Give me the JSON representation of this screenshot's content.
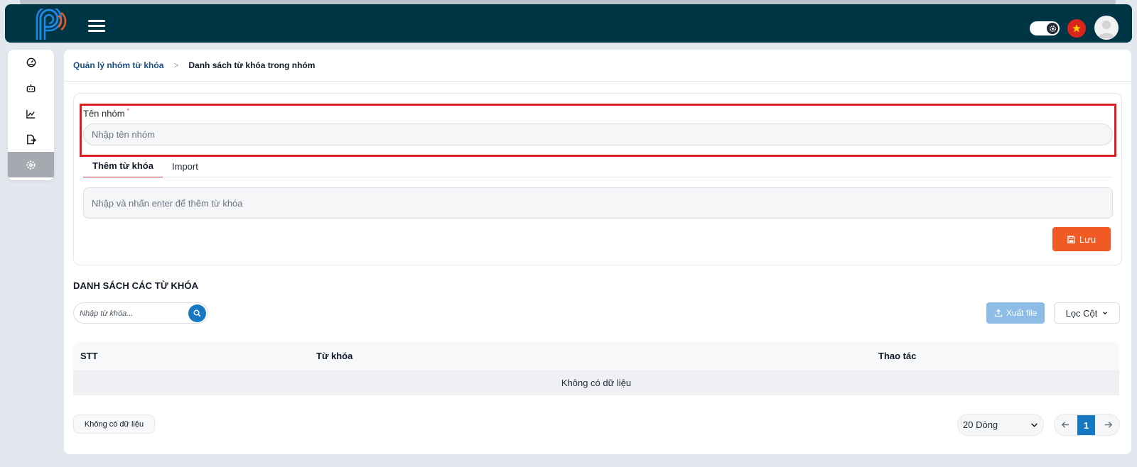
{
  "header": {
    "logo_icon": "p-signal-logo-icon",
    "menu_icon": "hamburger-menu-icon",
    "theme_toggle_icon": "gear-icon",
    "language_flag_icon": "vietnam-flag-icon",
    "avatar_icon": "user-avatar-icon"
  },
  "sidebar": {
    "items": [
      {
        "icon": "dashboard-icon",
        "active": false
      },
      {
        "icon": "robot-icon",
        "active": false
      },
      {
        "icon": "line-chart-icon",
        "active": false
      },
      {
        "icon": "file-export-icon",
        "active": false
      },
      {
        "icon": "settings-icon",
        "active": true
      }
    ]
  },
  "breadcrumb": {
    "parent": "Quản lý nhóm từ khóa",
    "separator": ">",
    "current": "Danh sách từ khóa trong nhóm"
  },
  "form": {
    "group_name_label": "Tên nhóm",
    "required_mark": "*",
    "group_name_placeholder": "Nhập tên nhóm",
    "group_name_value": "",
    "tabs": [
      {
        "label": "Thêm từ khóa",
        "active": true
      },
      {
        "label": "Import",
        "active": false
      }
    ],
    "keyword_placeholder": "Nhập và nhấn enter để thêm từ khóa",
    "save_label": "Lưu"
  },
  "keyword_list": {
    "title": "DANH SÁCH CÁC TỪ KHÓA",
    "search_placeholder": "Nhập từ khóa...",
    "export_label": "Xuất file",
    "filter_label": "Lọc Cột",
    "columns": [
      "STT",
      "Từ khóa",
      "Thao tác"
    ],
    "empty_text": "Không có dữ liệu",
    "summary_text": "Không có dữ liệu",
    "page_size_label": "20 Dòng",
    "current_page": "1"
  },
  "colors": {
    "topbar": "#003545",
    "accent_blue": "#1677c2",
    "save_orange": "#f15a24",
    "highlight_red": "#d91f26"
  }
}
